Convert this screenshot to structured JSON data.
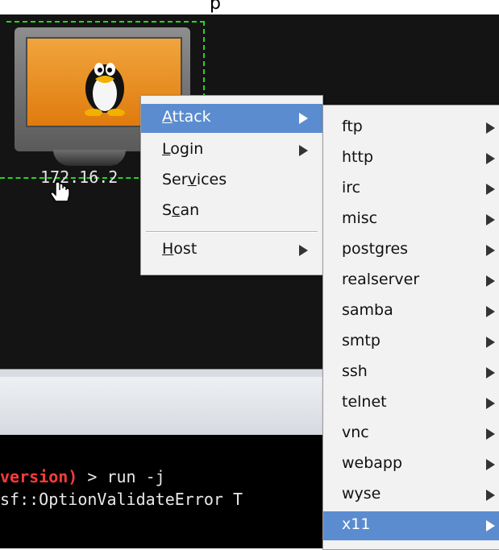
{
  "top_text": "p",
  "host": {
    "ip_label": "172.16.2"
  },
  "main_menu": {
    "items": [
      {
        "pre": "",
        "ul": "A",
        "post": "ttack",
        "has_submenu": true,
        "active": true
      },
      {
        "pre": "",
        "ul": "L",
        "post": "ogin",
        "has_submenu": true,
        "active": false
      },
      {
        "pre": "Ser",
        "ul": "v",
        "post": "ices",
        "has_submenu": false,
        "active": false
      },
      {
        "pre": "S",
        "ul": "c",
        "post": "an",
        "has_submenu": false,
        "active": false
      },
      {
        "pre": "",
        "ul": "H",
        "post": "ost",
        "has_submenu": true,
        "active": false
      }
    ]
  },
  "attack_submenu": {
    "items": [
      "ftp",
      "http",
      "irc",
      "misc",
      "postgres",
      "realserver",
      "samba",
      "smtp",
      "ssh",
      "telnet",
      "vnc",
      "webapp",
      "wyse",
      "x11"
    ],
    "active_index": 13
  },
  "console": {
    "line1_red": "version)",
    "line1_rest": " > run -j",
    "line2": "sf::OptionValidateError T"
  },
  "colors": {
    "highlight": "#5b8ccf",
    "canvas_bg": "#141414",
    "selection": "#22d622",
    "console_red": "#ff3b3b"
  }
}
